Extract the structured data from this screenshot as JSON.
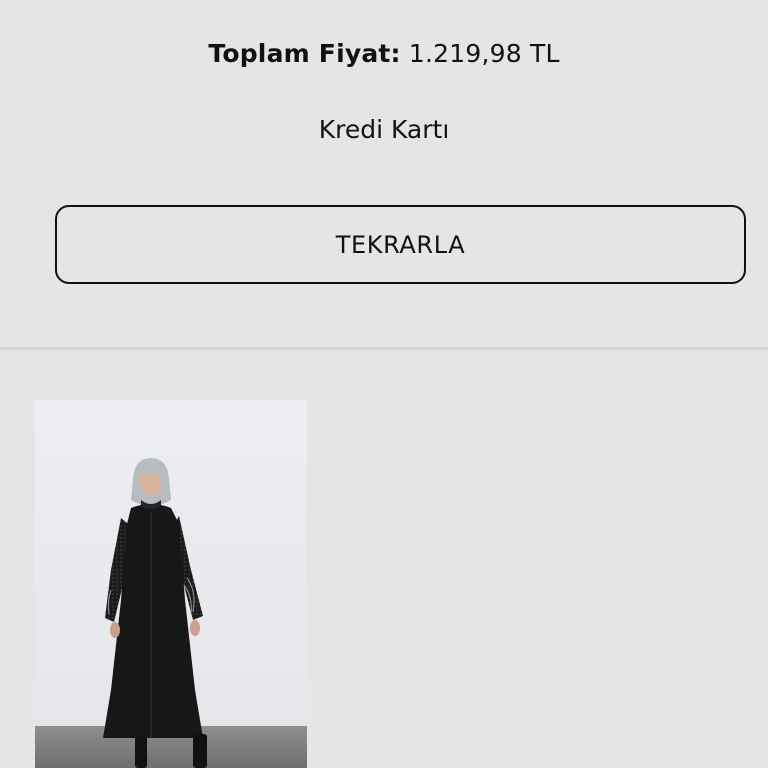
{
  "order_summary": {
    "total_label": "Toplam Fiyat:",
    "total_value": "1.219,98 TL",
    "payment_method": "Kredi Kartı",
    "repeat_button_label": "TEKRARLA"
  },
  "products": [
    {
      "image_icon": "product-photo-black-abaya"
    }
  ],
  "colors": {
    "background": "#e5e5e5",
    "text": "#111111",
    "divider": "#d2d2d2"
  }
}
